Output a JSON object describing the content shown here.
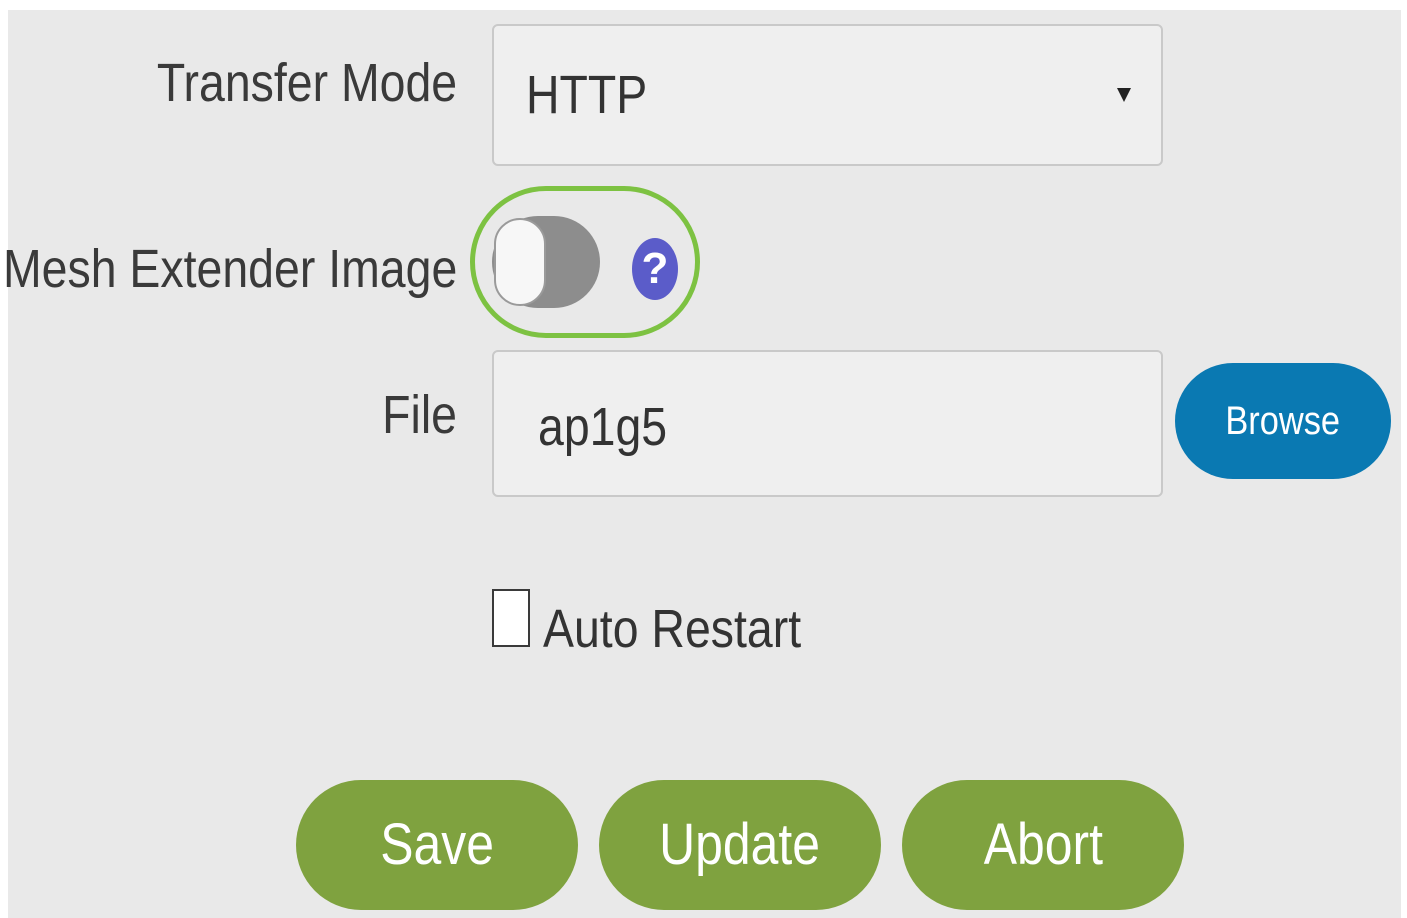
{
  "form": {
    "transfer_mode": {
      "label": "Transfer Mode",
      "value": "HTTP"
    },
    "mesh_extender": {
      "label": "Mesh Extender Image",
      "toggle_on": false,
      "help_glyph": "?"
    },
    "file": {
      "label": "File",
      "value": "ap1g5",
      "browse_label": "Browse"
    },
    "auto_restart": {
      "label": "Auto Restart",
      "checked": false
    }
  },
  "actions": {
    "save_label": "Save",
    "update_label": "Update",
    "abort_label": "Abort"
  },
  "colors": {
    "highlight": "#7dc242",
    "browse": "#0a79b2",
    "action": "#7fa23f",
    "help": "#5b5cc9"
  }
}
